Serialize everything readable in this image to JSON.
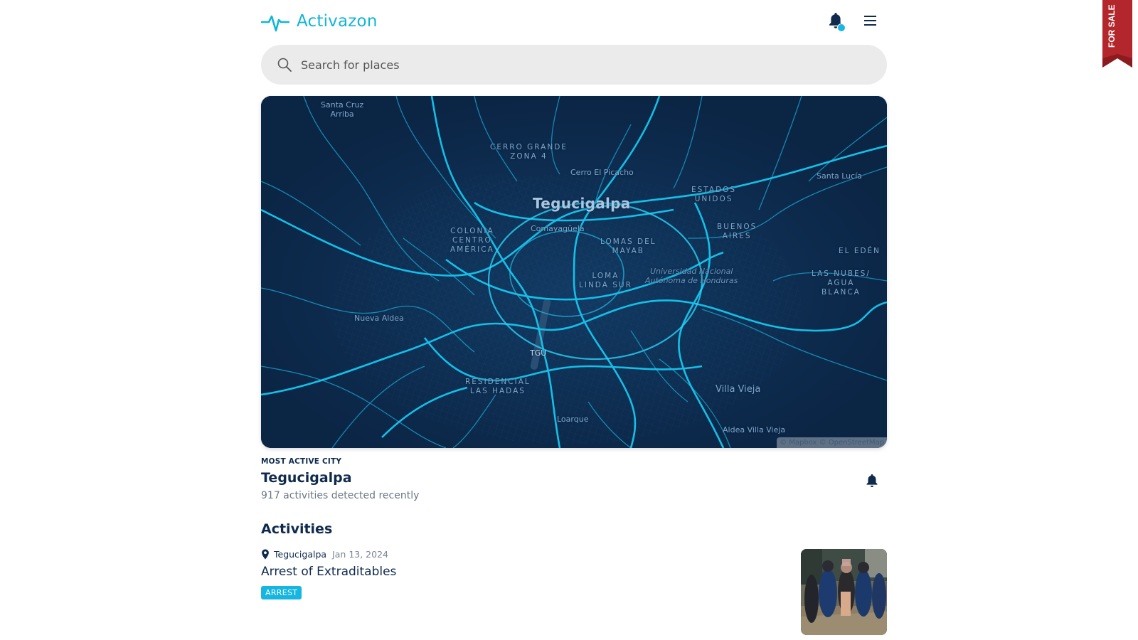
{
  "app": {
    "name": "Activazon"
  },
  "header": {
    "notifications_icon": "bell-icon",
    "menu_icon": "hamburger-menu-icon"
  },
  "search": {
    "placeholder": "Search for places"
  },
  "map": {
    "labels": {
      "santa_cruz": "Santa Cruz\nArriba",
      "cerro_grande": "CERRO GRANDE\nZONA 4",
      "cerro_picacho": "Cerro El Picacho",
      "santa_lucia": "Santa Lucía",
      "estados_unidos": "ESTADOS\nUNIDOS",
      "tegucigalpa": "Tegucigalpa",
      "comayaguela": "Comayagüela",
      "colonia": "COLONIA\nCENTRO\nAMÉRICA",
      "lomas_mayab": "LOMAS DEL\nMAYAB",
      "buenos_aires": "BUENOS\nAIRES",
      "el_eden": "EL EDÉN",
      "universidad": "Universidad Nacional\nAutónoma de Honduras",
      "loma_linda": "LOMA\nLINDA SUR",
      "las_nubes": "LAS NUBES/\nAGUA\nBLANCA",
      "nueva_aldea": "Nueva Aldea",
      "tgu": "TGU",
      "residencial": "RESIDENCIAL\nLAS HADAS",
      "villa_vieja": "Villa Vieja",
      "loarque": "Loarque",
      "aldea_villa_vieja": "Aldea Villa Vieja"
    },
    "attribution": "© Mapbox © OpenStreetMap"
  },
  "most_active": {
    "kicker": "MOST ACTIVE CITY",
    "city": "Tegucigalpa",
    "count_text": "917 activities detected recently"
  },
  "activities": {
    "title": "Activities",
    "items": [
      {
        "location": "Tegucigalpa",
        "date": "Jan 13, 2024",
        "headline": "Arrest of Extraditables",
        "badge": "ARREST"
      }
    ]
  },
  "ribbon": {
    "text": "FOR SALE"
  },
  "colors": {
    "accent": "#11b5d8",
    "navy": "#0f2a4d",
    "map_bg": "#0b2545",
    "ribbon": "#b3262b"
  }
}
